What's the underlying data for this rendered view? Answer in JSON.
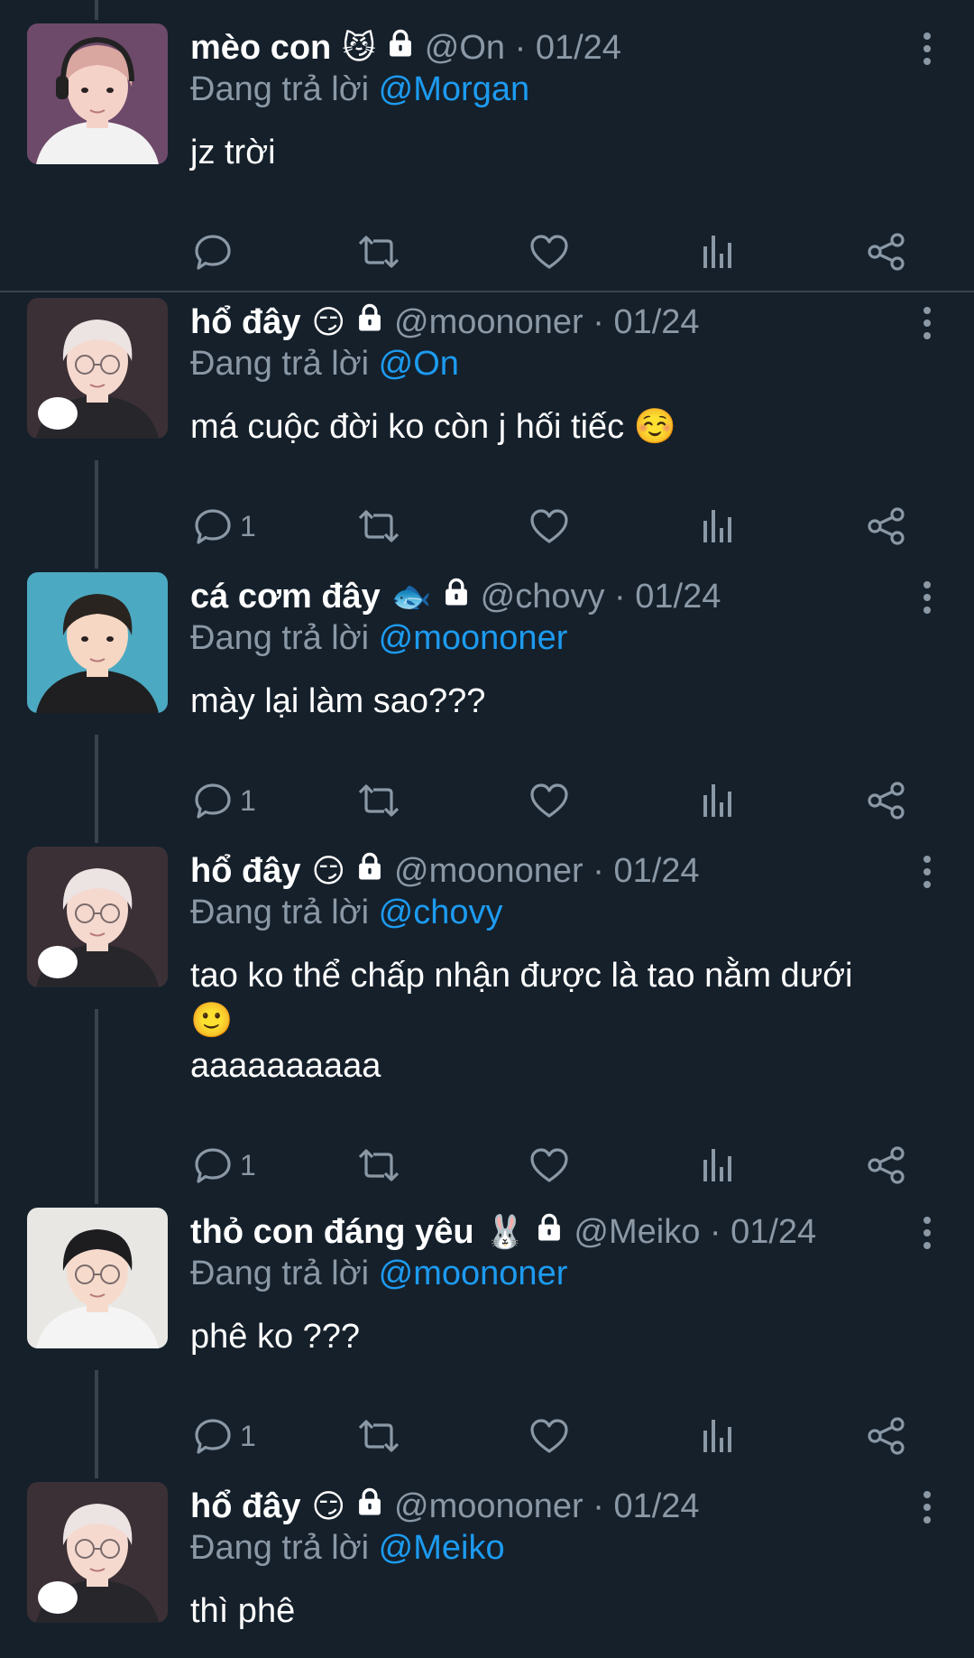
{
  "colors": {
    "background": "#15202b",
    "text_primary": "#ffffff",
    "text_secondary": "#8b98a5",
    "mention": "#1d9bf0",
    "thread_line": "#38444d"
  },
  "reply_prefix": "Đang trả lời",
  "tweets": [
    {
      "name": "mèo con",
      "emoji": "😼",
      "handle": "@On",
      "date": "01/24",
      "handle_date": "@On · 01/24",
      "reply_to": "@Morgan",
      "text": "jz trời",
      "reply_count": "",
      "icons": [
        "lock-icon",
        "more-icon",
        "reply-icon",
        "retweet-icon",
        "like-icon",
        "views-icon",
        "share-icon"
      ]
    },
    {
      "name": "hổ đây",
      "emoji": "😏",
      "handle": "@moononer",
      "date": "01/24",
      "handle_date": "@moononer · 01/24",
      "reply_to": "@On",
      "text": "má cuộc đời ko còn j hối tiếc ☺️",
      "reply_count": "1"
    },
    {
      "name": "cá cơm đây",
      "emoji": "🐟",
      "handle": "@chovy",
      "date": "01/24",
      "handle_date": "@chovy · 01/24",
      "reply_to": "@moononer",
      "text": "mày lại làm sao???",
      "reply_count": "1"
    },
    {
      "name": "hổ đây",
      "emoji": "😏",
      "handle": "@moononer",
      "date": "01/24",
      "handle_date": "@moononer · 01/24",
      "reply_to": "@chovy",
      "text": "tao ko thể chấp nhận được là tao nằm dưới\n🙂\naaaaaaaaaa",
      "reply_count": "1"
    },
    {
      "name": "thỏ con đáng yêu",
      "emoji": "🐰",
      "handle": "@Meiko",
      "date": "01/24",
      "handle_date": "@Meiko · 01/24",
      "reply_to": "@moononer",
      "text": "phê ko ???",
      "reply_count": "1"
    },
    {
      "name": "hổ đây",
      "emoji": "😏",
      "handle": "@moononer",
      "date": "01/24",
      "handle_date": "@moononer · 01/24",
      "reply_to": "@Meiko",
      "text": "thì phê",
      "reply_count": ""
    }
  ]
}
